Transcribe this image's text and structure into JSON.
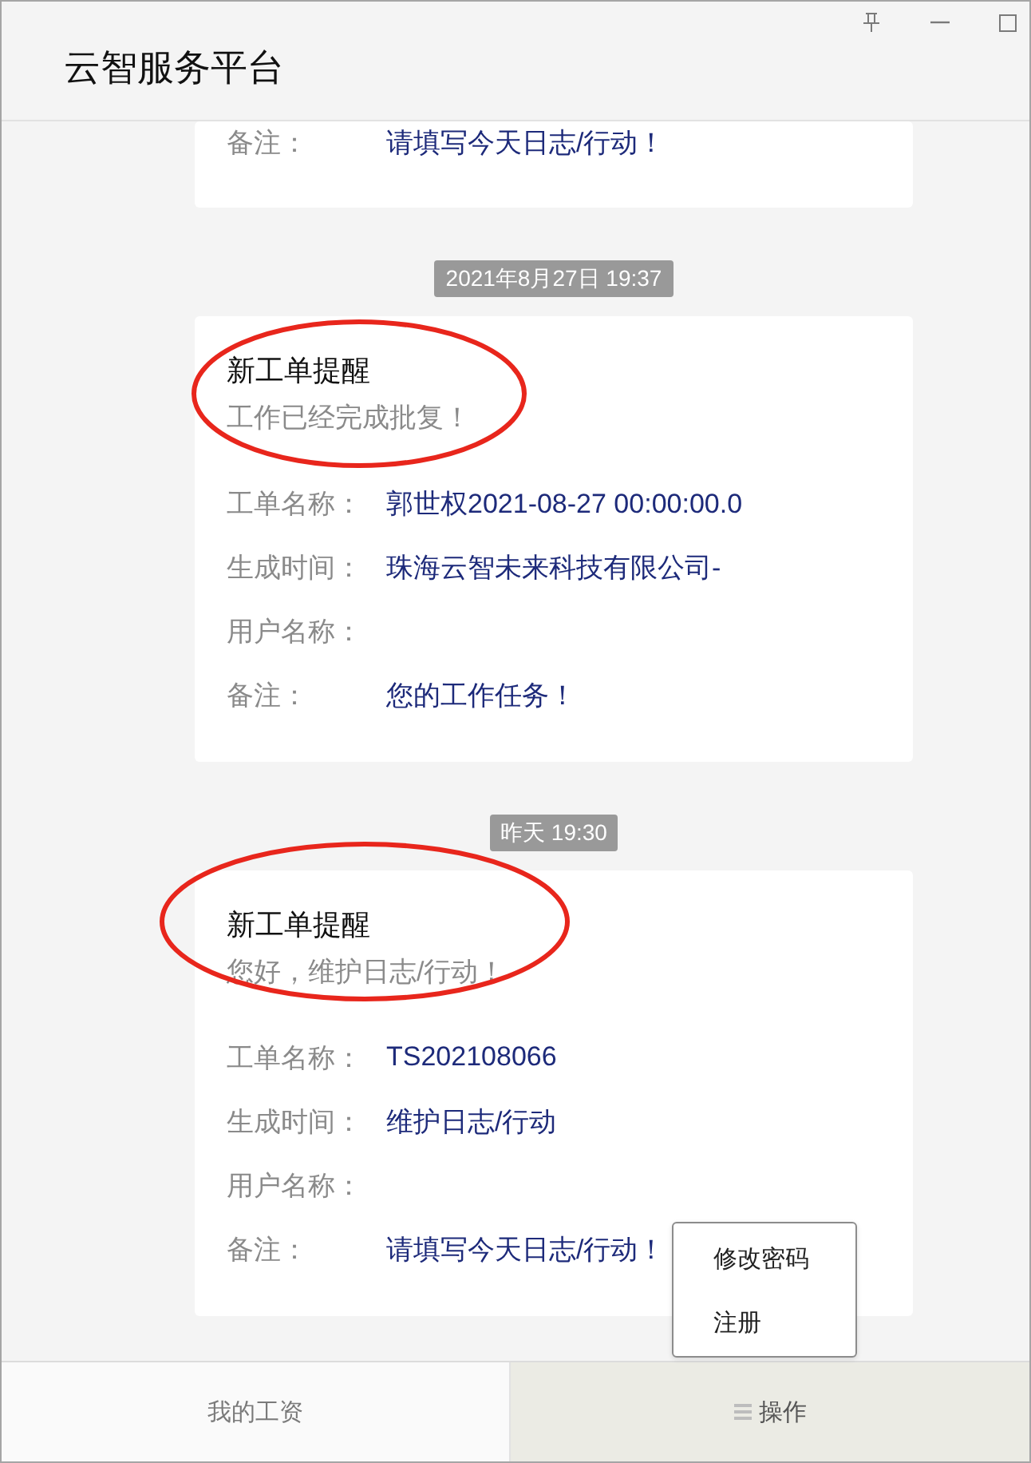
{
  "window": {
    "title": "云智服务平台"
  },
  "messages": [
    {
      "rows": [
        {
          "label": "备注：",
          "value": "请填写今天日志/行动！"
        }
      ]
    },
    {
      "timestamp": "2021年8月27日 19:37",
      "title": "新工单提醒",
      "subtitle": "工作已经完成批复！",
      "highlighted": true,
      "rows": [
        {
          "label": "工单名称：",
          "value": "郭世权2021-08-27 00:00:00.0"
        },
        {
          "label": "生成时间：",
          "value": "珠海云智未来科技有限公司-"
        },
        {
          "label": "用户名称："
        },
        {
          "label": "备注：",
          "value": "您的工作任务！"
        }
      ]
    },
    {
      "timestamp": "昨天 19:30",
      "title": "新工单提醒",
      "subtitle": "您好，维护日志/行动！",
      "highlighted": true,
      "rows": [
        {
          "label": "工单名称：",
          "value": "TS202108066"
        },
        {
          "label": "生成时间：",
          "value": "维护日志/行动"
        },
        {
          "label": "用户名称："
        },
        {
          "label": "备注：",
          "value": "请填写今天日志/行动！"
        }
      ]
    }
  ],
  "tabs": [
    {
      "label": "我的工资",
      "kind": "plain",
      "selected": false
    },
    {
      "label": "操作",
      "kind": "menu",
      "selected": true
    }
  ],
  "popup_menu": {
    "items": [
      "修改密码",
      "注册"
    ]
  }
}
